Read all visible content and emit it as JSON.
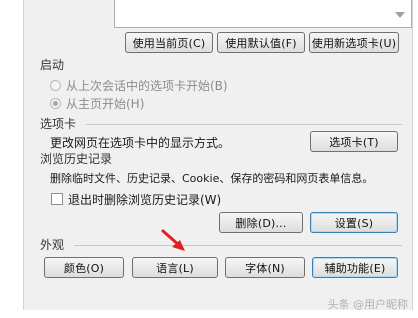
{
  "homepage": {
    "use_current": "使用当前页(C)",
    "use_default": "使用默认值(F)",
    "use_new_tab": "使用新选项卡(U)"
  },
  "startup": {
    "header": "启动",
    "option_last_session": "从上次会话中的选项卡开始(B)",
    "option_homepage": "从主页开始(H)",
    "selected": "option_homepage"
  },
  "tabs": {
    "header": "选项卡",
    "description": "更改网页在选项卡中的显示方式。",
    "button": "选项卡(T)"
  },
  "history": {
    "header": "浏览历史记录",
    "description": "删除临时文件、历史记录、Cookie、保存的密码和网页表单信息。",
    "delete_on_exit": "退出时删除浏览历史记录(W)",
    "delete_on_exit_checked": false,
    "delete_button": "删除(D)...",
    "settings_button": "设置(S)"
  },
  "appearance": {
    "header": "外观",
    "colors": "颜色(O)",
    "languages": "语言(L)",
    "fonts": "字体(N)",
    "accessibility": "辅助功能(E)"
  },
  "annotation": {
    "arrow_color": "#e02020"
  },
  "watermark": "头条 @用户昵称"
}
